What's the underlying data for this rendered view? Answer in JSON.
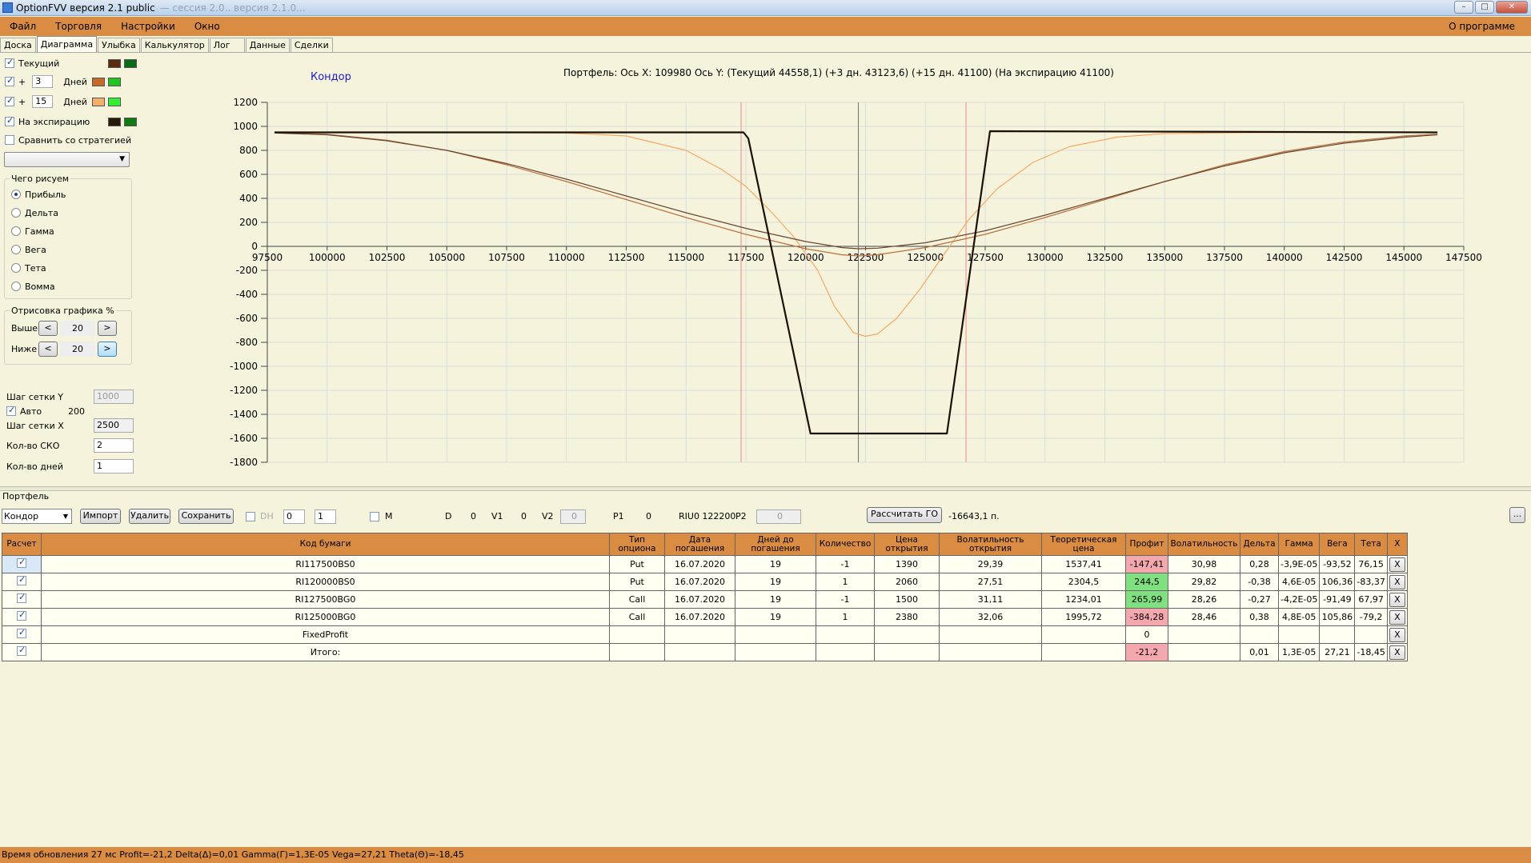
{
  "window": {
    "title": "OptionFVV версия 2.1 public",
    "title_blurred": "— сессия 2.0.. версия 2.1.0..."
  },
  "menu": {
    "items": [
      "Файл",
      "Торговля",
      "Настройки",
      "Окно"
    ],
    "about": "О программе"
  },
  "tabs": [
    "Доска",
    "Диаграмма",
    "Улыбка",
    "Калькулятор",
    "Лог",
    "Данные",
    "Сделки"
  ],
  "active_tab": "Диаграмма",
  "left": {
    "current_label": "Текущий",
    "plus": "+",
    "days_a": "3",
    "days_b": "15",
    "days_label": "Дней",
    "expiry_label": "На экспирацию",
    "compare_label": "Сравнить со стратегией",
    "draw_group_title": "Чего рисуем",
    "draw_options": [
      "Прибыль",
      "Дельта",
      "Гамма",
      "Вега",
      "Тета",
      "Вомма"
    ],
    "draw_selected": "Прибыль",
    "render_group_title": "Отрисовка графика %",
    "above_label": "Выше",
    "below_label": "Ниже",
    "above_value": "20",
    "below_value": "20",
    "prev_glyph": "<",
    "next_glyph": ">",
    "grid_y_label": "Шаг сетки Y",
    "grid_y_value": "1000",
    "auto_label": "Авто",
    "auto_value": "200",
    "grid_x_label": "Шаг сетки X",
    "grid_x_value": "2500",
    "sko_label": "Кол-во СКО",
    "sko_value": "2",
    "days_count_label": "Кол-во дней",
    "days_count_value": "1",
    "swatch_colors": {
      "current": [
        "#5a2a12",
        "#0a6a1a"
      ],
      "plus3": [
        "#c46a2a",
        "#22c422"
      ],
      "plus15": [
        "#f4b06a",
        "#33ee33"
      ],
      "expiry": [
        "#2a1a0a",
        "#127a12"
      ]
    }
  },
  "chart_data": {
    "type": "line",
    "title": "Кондор",
    "info": "Портфель: Ось X: 109980 Ось Y:  (Текущий 44558,1)  (+3 дн. 43123,6)  (+15 дн. 41100)  (На экспирацию 41100)",
    "xlim": [
      97500,
      147500
    ],
    "ylim": [
      -1800,
      1200
    ],
    "x_ticks": [
      "97500",
      "100000",
      "102500",
      "105000",
      "107500",
      "110000",
      "112500",
      "115000",
      "117500",
      "120000",
      "122500",
      "125000",
      "127500",
      "130000",
      "132500",
      "135000",
      "137500",
      "140000",
      "142500",
      "145000",
      "147500"
    ],
    "y_ticks": [
      "1200",
      "1000",
      "800",
      "600",
      "400",
      "200",
      "0",
      "-200",
      "-400",
      "-600",
      "-800",
      "-1000",
      "-1200",
      "-1400",
      "-1600",
      "-1800"
    ],
    "vlines": {
      "current_price": 122200,
      "sko_left": 117300,
      "sko_right": 126700
    },
    "series": [
      {
        "name": "На экспирацию",
        "color": "#1a0f05",
        "width": 2.2,
        "points": [
          [
            97800,
            950
          ],
          [
            117400,
            950
          ],
          [
            117600,
            900
          ],
          [
            120200,
            -1560
          ],
          [
            125900,
            -1560
          ],
          [
            127700,
            960
          ],
          [
            146400,
            950
          ]
        ]
      },
      {
        "name": "Текущий",
        "color": "#6b4630",
        "width": 1.2,
        "points": [
          [
            97800,
            945
          ],
          [
            100000,
            930
          ],
          [
            102500,
            880
          ],
          [
            105000,
            800
          ],
          [
            107500,
            690
          ],
          [
            110000,
            560
          ],
          [
            112500,
            420
          ],
          [
            115000,
            280
          ],
          [
            117500,
            150
          ],
          [
            120000,
            40
          ],
          [
            121500,
            -10
          ],
          [
            122200,
            -20
          ],
          [
            123000,
            -15
          ],
          [
            125000,
            30
          ],
          [
            127500,
            130
          ],
          [
            130000,
            260
          ],
          [
            132500,
            400
          ],
          [
            135000,
            540
          ],
          [
            137500,
            670
          ],
          [
            140000,
            780
          ],
          [
            142500,
            860
          ],
          [
            145000,
            910
          ],
          [
            146400,
            930
          ]
        ]
      },
      {
        "name": "+3 дн.",
        "color": "#b8703c",
        "width": 1.2,
        "points": [
          [
            97800,
            948
          ],
          [
            100000,
            935
          ],
          [
            102500,
            885
          ],
          [
            105000,
            800
          ],
          [
            107500,
            680
          ],
          [
            110000,
            540
          ],
          [
            112500,
            390
          ],
          [
            115000,
            240
          ],
          [
            117500,
            100
          ],
          [
            120000,
            -20
          ],
          [
            121500,
            -70
          ],
          [
            122200,
            -80
          ],
          [
            123000,
            -70
          ],
          [
            125000,
            -10
          ],
          [
            127500,
            100
          ],
          [
            130000,
            240
          ],
          [
            132500,
            390
          ],
          [
            135000,
            540
          ],
          [
            137500,
            680
          ],
          [
            140000,
            790
          ],
          [
            142500,
            870
          ],
          [
            145000,
            920
          ],
          [
            146400,
            935
          ]
        ]
      },
      {
        "name": "+15 дн.",
        "color": "#f5a964",
        "width": 1.2,
        "points": [
          [
            97800,
            950
          ],
          [
            105000,
            950
          ],
          [
            110000,
            945
          ],
          [
            112500,
            920
          ],
          [
            115000,
            800
          ],
          [
            116500,
            640
          ],
          [
            117500,
            500
          ],
          [
            118500,
            300
          ],
          [
            119500,
            80
          ],
          [
            120500,
            -200
          ],
          [
            121200,
            -500
          ],
          [
            122000,
            -720
          ],
          [
            122500,
            -750
          ],
          [
            123000,
            -730
          ],
          [
            123800,
            -600
          ],
          [
            124800,
            -350
          ],
          [
            125800,
            -60
          ],
          [
            126800,
            220
          ],
          [
            128000,
            480
          ],
          [
            129500,
            700
          ],
          [
            131000,
            830
          ],
          [
            133000,
            910
          ],
          [
            135000,
            940
          ],
          [
            140000,
            950
          ],
          [
            146400,
            950
          ]
        ]
      }
    ]
  },
  "portfolio": {
    "label": "Портфель",
    "selected": "Кондор",
    "import_btn": "Импорт",
    "delete_btn": "Удалить",
    "save_btn": "Сохранить",
    "dh_label": "DH",
    "dh_a": "0",
    "dh_b": "1",
    "m_label": "M",
    "d_label": "D",
    "d_value": "0",
    "v1_label": "V1",
    "v1_value": "0",
    "v2_label": "V2",
    "v2_value": "0",
    "p1_label": "P1",
    "p1_value": "0",
    "riu_label": "RIU0 122200",
    "p2_label": "P2",
    "p2_value": "0",
    "calc_go_btn": "Рассчитать ГО",
    "go_value": "-16643,1 п.",
    "more_btn": "..."
  },
  "table": {
    "headers": [
      "Расчет",
      "Код бумаги",
      "Тип опциона",
      "Дата погашения",
      "Дней до погашения",
      "Количество",
      "Цена открытия",
      "Волатильность открытия",
      "Теоретическая цена",
      "Профит",
      "Волатильность",
      "Дельта",
      "Гамма",
      "Вега",
      "Тета",
      "X"
    ],
    "rows": [
      {
        "code": "RI117500BS0",
        "type": "Put",
        "date": "16.07.2020",
        "days": "19",
        "qty": "-1",
        "open": "1390",
        "vol_open": "29,39",
        "theo": "1537,41",
        "profit": "-147,41",
        "profit_bg": "pink",
        "vol": "30,98",
        "delta": "0,28",
        "gamma": "-3,9E-05",
        "vega": "-93,52",
        "theta": "76,15",
        "x": "X"
      },
      {
        "code": "RI120000BS0",
        "type": "Put",
        "date": "16.07.2020",
        "days": "19",
        "qty": "1",
        "open": "2060",
        "vol_open": "27,51",
        "theo": "2304,5",
        "profit": "244,5",
        "profit_bg": "green",
        "vol": "29,82",
        "delta": "-0,38",
        "gamma": "4,6E-05",
        "vega": "106,36",
        "theta": "-83,37",
        "x": "X"
      },
      {
        "code": "RI127500BG0",
        "type": "Call",
        "date": "16.07.2020",
        "days": "19",
        "qty": "-1",
        "open": "1500",
        "vol_open": "31,11",
        "theo": "1234,01",
        "profit": "265,99",
        "profit_bg": "green",
        "vol": "28,26",
        "delta": "-0,27",
        "gamma": "-4,2E-05",
        "vega": "-91,49",
        "theta": "67,97",
        "x": "X"
      },
      {
        "code": "RI125000BG0",
        "type": "Call",
        "date": "16.07.2020",
        "days": "19",
        "qty": "1",
        "open": "2380",
        "vol_open": "32,06",
        "theo": "1995,72",
        "profit": "-384,28",
        "profit_bg": "pink",
        "vol": "28,46",
        "delta": "0,38",
        "gamma": "4,8E-05",
        "vega": "105,86",
        "theta": "-79,2",
        "x": "X"
      },
      {
        "code": "FixedProfit",
        "type": "",
        "date": "",
        "days": "",
        "qty": "",
        "open": "",
        "vol_open": "",
        "theo": "",
        "profit": "0",
        "profit_bg": "",
        "vol": "",
        "delta": "",
        "gamma": "",
        "vega": "",
        "theta": "",
        "x": "X"
      },
      {
        "code": "Итого:",
        "type": "",
        "date": "",
        "days": "",
        "qty": "",
        "open": "",
        "vol_open": "",
        "theo": "",
        "profit": "-21,2",
        "profit_bg": "pink",
        "vol": "",
        "delta": "0,01",
        "gamma": "1,3E-05",
        "vega": "27,21",
        "theta": "-18,45",
        "x": "X"
      }
    ]
  },
  "status": {
    "text": "Время обновления 27 мс  Profit=-21,2 Delta(Δ)=0,01 Gamma(Γ)=1,3E-05 Vega=27,21 Theta(Θ)=-18,45"
  }
}
